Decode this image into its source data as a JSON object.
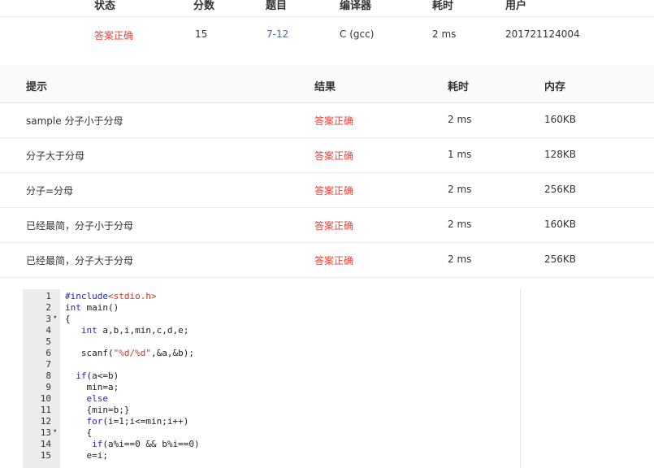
{
  "summary": {
    "headers": [
      "状态",
      "分数",
      "题目",
      "编译器",
      "耗时",
      "用户"
    ],
    "row": {
      "status": "答案正确",
      "score": "15",
      "problem": "7-12",
      "compiler": "C (gcc)",
      "time": "2 ms",
      "user": "201721124004"
    }
  },
  "tests": {
    "headers": {
      "hint": "提示",
      "result": "结果",
      "time": "耗时",
      "memory": "内存"
    },
    "rows": [
      {
        "hint": "sample 分子小于分母",
        "result": "答案正确",
        "time": "2 ms",
        "memory": "160KB"
      },
      {
        "hint": "分子大于分母",
        "result": "答案正确",
        "time": "1 ms",
        "memory": "128KB"
      },
      {
        "hint": "分子=分母",
        "result": "答案正确",
        "time": "2 ms",
        "memory": "256KB"
      },
      {
        "hint": "已经最简，分子小于分母",
        "result": "答案正确",
        "time": "2 ms",
        "memory": "160KB"
      },
      {
        "hint": "已经最简，分子大于分母",
        "result": "答案正确",
        "time": "2 ms",
        "memory": "256KB"
      }
    ]
  },
  "code": {
    "lines": [
      {
        "n": "1",
        "fold": "",
        "text": "#include<stdio.h>"
      },
      {
        "n": "2",
        "fold": "",
        "text": "int main()"
      },
      {
        "n": "3",
        "fold": "▾",
        "text": "{"
      },
      {
        "n": "4",
        "fold": "",
        "text": "   int a,b,i,min,c,d,e;"
      },
      {
        "n": "5",
        "fold": "",
        "text": ""
      },
      {
        "n": "6",
        "fold": "",
        "text": "   scanf(\"%d/%d\",&a,&b);"
      },
      {
        "n": "7",
        "fold": "",
        "text": ""
      },
      {
        "n": "8",
        "fold": "",
        "text": "  if(a<=b)"
      },
      {
        "n": "9",
        "fold": "",
        "text": "    min=a;"
      },
      {
        "n": "10",
        "fold": "",
        "text": "    else"
      },
      {
        "n": "11",
        "fold": "",
        "text": "    {min=b;}"
      },
      {
        "n": "12",
        "fold": "",
        "text": "    for(i=1;i<=min;i++)"
      },
      {
        "n": "13",
        "fold": "▾",
        "text": "    {"
      },
      {
        "n": "14",
        "fold": "",
        "text": "     if(a%i==0 && b%i==0)"
      },
      {
        "n": "15",
        "fold": "",
        "text": "    e=i;"
      }
    ]
  }
}
